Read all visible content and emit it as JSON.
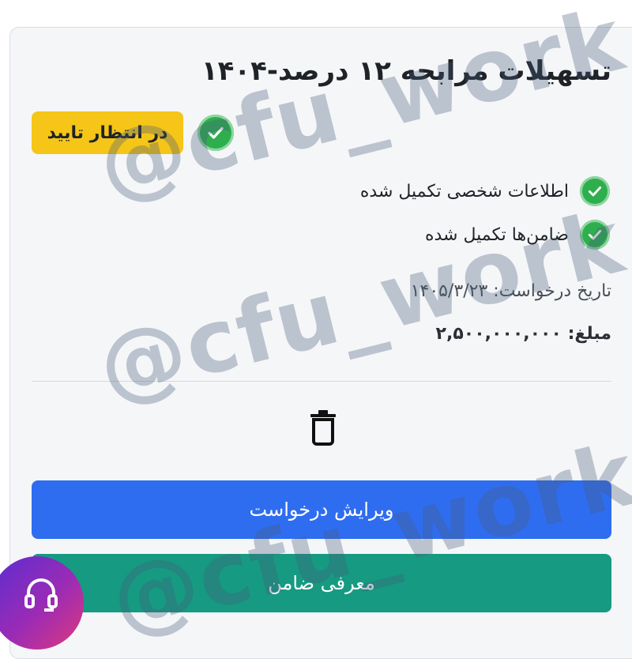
{
  "card": {
    "title": "تسهیلات مرابحه ۱۲ درصد-۱۴۰۴",
    "status_label": "در انتظار تایید",
    "checklist": [
      {
        "label": "اطلاعات شخصی تکمیل شده",
        "icon": "check-circle-icon"
      },
      {
        "label": "ضامن‌ها تکمیل شده",
        "icon": "check-circle-icon"
      }
    ],
    "date_label": "تاریخ درخواست:",
    "date_value": "۱۴۰۵/۳/۲۳",
    "amount_label": "مبلغ:",
    "amount_value": "۲,۵۰۰,۰۰۰,۰۰۰",
    "delete_icon": "trash-icon",
    "edit_button_label": "ویرایش درخواست",
    "guarantor_button_label": "معرفی ضامن"
  },
  "support_icon": "headset-icon",
  "watermark_text": "@cfu_work",
  "colors": {
    "status_badge": "#f5c518",
    "check": "#2fae4e",
    "edit_button": "#2f6df0",
    "guarantor_button": "#169a82"
  }
}
